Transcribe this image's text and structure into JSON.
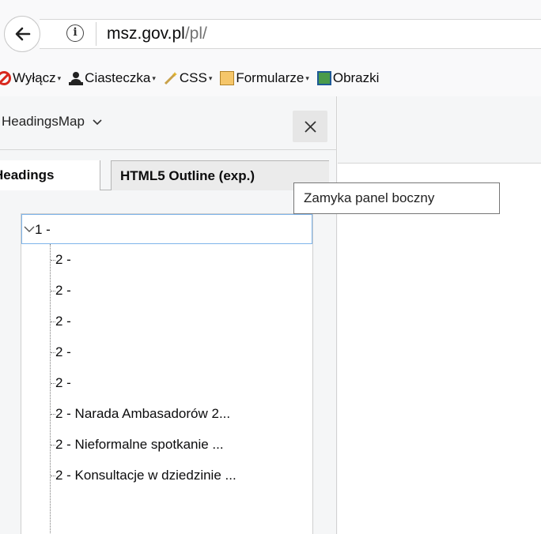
{
  "urlbar": {
    "host": "msz.gov.pl",
    "path": "/pl/",
    "info_glyph": "i"
  },
  "bookmarks": [
    {
      "label": "Wyłącz",
      "icon": "disable-icon"
    },
    {
      "label": "Ciasteczka",
      "icon": "cookie-icon"
    },
    {
      "label": "CSS",
      "icon": "css-wand-icon"
    },
    {
      "label": "Formularze",
      "icon": "clipboard-icon"
    },
    {
      "label": "Obrazki",
      "icon": "image-icon"
    }
  ],
  "sidebar": {
    "title": "HeadingsMap",
    "tabs": [
      {
        "label": "Headings"
      },
      {
        "label": "HTML5 Outline (exp.)"
      }
    ],
    "tree": {
      "root": "1 -",
      "items": [
        "2 -",
        "2 -",
        "2 -",
        "2 -",
        "2 -",
        "2 - Narada Ambasadorów 2...",
        "2 - Nieformalne spotkanie ...",
        "2 - Konsultacje w dziedzinie ..."
      ]
    }
  },
  "tooltip": {
    "text": "Zamyka panel boczny"
  },
  "colors": {
    "focus_border": "#7eb4ea",
    "disable_red": "#d8281e",
    "sidebar_bg": "#f5f6f7"
  }
}
